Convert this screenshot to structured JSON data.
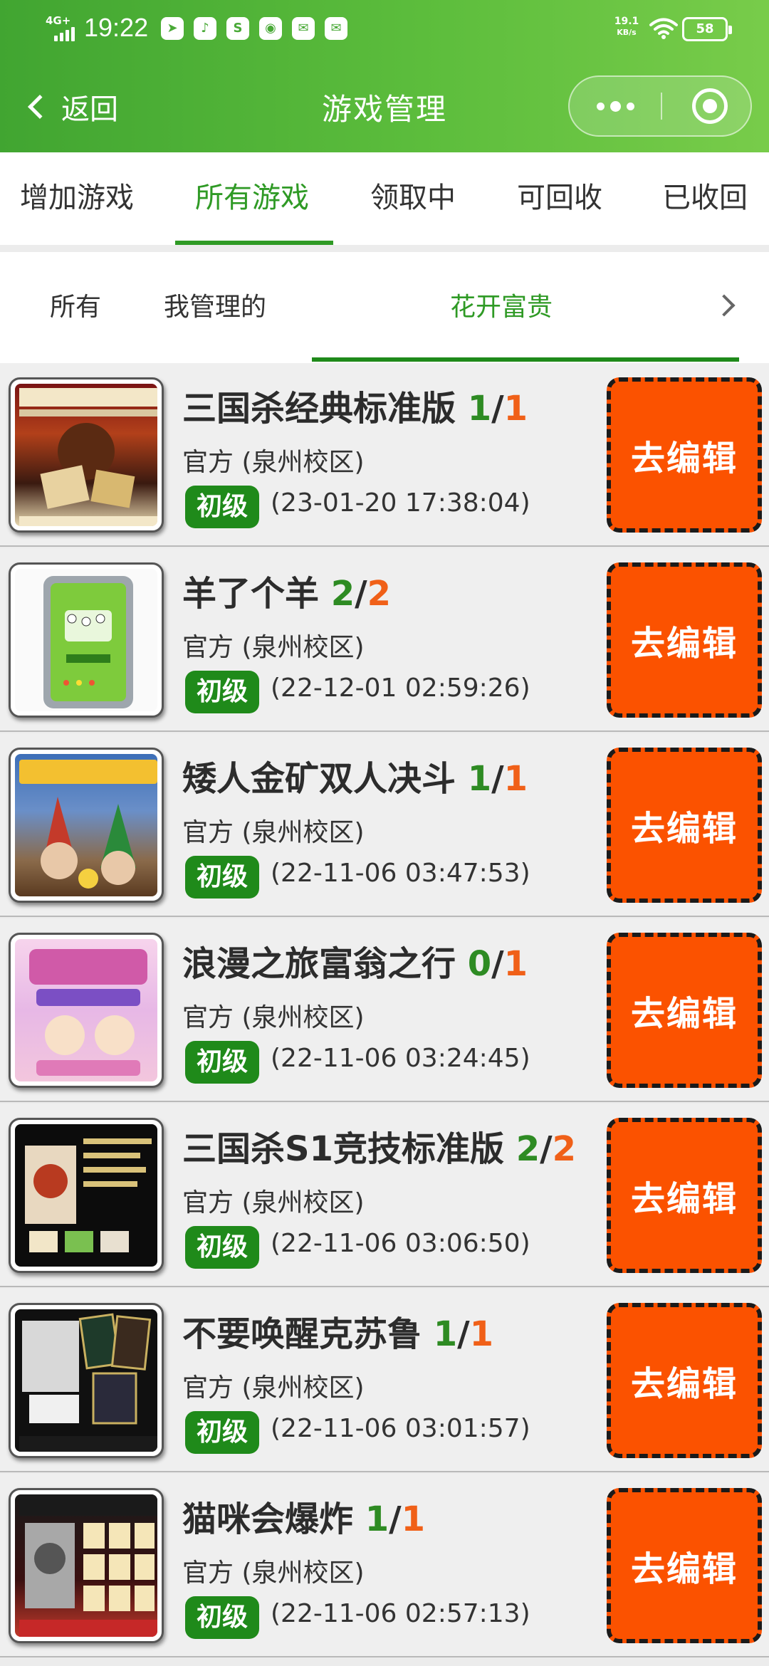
{
  "status_bar": {
    "network": "4G+",
    "time": "19:22",
    "app_icons": [
      "telegram-icon",
      "tiktok-icon",
      "soul-icon",
      "bilibili-icon",
      "mail-icon",
      "mail-icon"
    ],
    "speed_value": "19.1",
    "speed_unit": "KB/s",
    "battery": "58"
  },
  "nav": {
    "back_label": "返回",
    "title": "游戏管理"
  },
  "main_tabs": [
    "增加游戏",
    "所有游戏",
    "领取中",
    "可回收",
    "已收回"
  ],
  "main_tab_active": 1,
  "sub_tabs": [
    "所有",
    "我管理的",
    "花开富贵"
  ],
  "sub_tab_active": 2,
  "colors": {
    "brand_green": "#2f9a25",
    "header_green": "#4caf38",
    "edit_orange": "#fb5200",
    "count_available": "#2e8b23",
    "count_total": "#f06018"
  },
  "games": [
    {
      "name": "三国杀经典标准版",
      "available": "1",
      "total": "1",
      "owner": "官方 (泉州校区)",
      "level": "初级",
      "time": "(23-01-20 17:38:04)",
      "edit_label": "去编辑"
    },
    {
      "name": "羊了个羊",
      "available": "2",
      "total": "2",
      "owner": "官方 (泉州校区)",
      "level": "初级",
      "time": "(22-12-01 02:59:26)",
      "edit_label": "去编辑"
    },
    {
      "name": "矮人金矿双人决斗",
      "available": "1",
      "total": "1",
      "owner": "官方 (泉州校区)",
      "level": "初级",
      "time": "(22-11-06 03:47:53)",
      "edit_label": "去编辑"
    },
    {
      "name": "浪漫之旅富翁之行",
      "available": "0",
      "total": "1",
      "owner": "官方 (泉州校区)",
      "level": "初级",
      "time": "(22-11-06 03:24:45)",
      "edit_label": "去编辑"
    },
    {
      "name": "三国杀S1竞技标准版",
      "available": "2",
      "total": "2",
      "owner": "官方 (泉州校区)",
      "level": "初级",
      "time": "(22-11-06 03:06:50)",
      "edit_label": "去编辑"
    },
    {
      "name": "不要唤醒克苏鲁",
      "available": "1",
      "total": "1",
      "owner": "官方 (泉州校区)",
      "level": "初级",
      "time": "(22-11-06 03:01:57)",
      "edit_label": "去编辑"
    },
    {
      "name": "猫咪会爆炸",
      "available": "1",
      "total": "1",
      "owner": "官方 (泉州校区)",
      "level": "初级",
      "time": "(22-11-06 02:57:13)",
      "edit_label": "去编辑"
    }
  ]
}
